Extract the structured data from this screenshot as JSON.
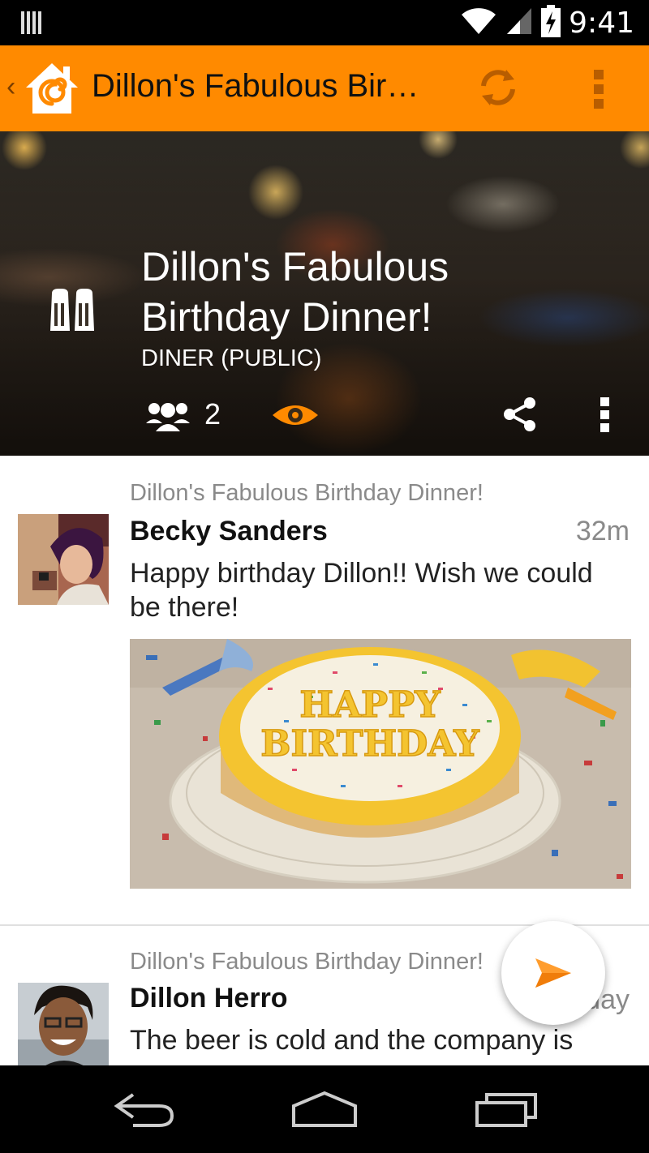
{
  "status_bar": {
    "time": "9:41"
  },
  "action_bar": {
    "title": "Dillon's Fabulous Birt…"
  },
  "event": {
    "title": "Dillon's Fabulous Birthday Dinner!",
    "type_label": "DINER (PUBLIC)",
    "attendee_count": "2"
  },
  "posts": [
    {
      "event_title": "Dillon's Fabulous Birthday Dinner!",
      "author": "Becky Sanders",
      "time": "32m",
      "message": "Happy birthday Dillon!! Wish we could be there!",
      "photo_text": "HAPPY BIRTHDAY"
    },
    {
      "event_title": "Dillon's Fabulous Birthday Dinner!",
      "author": "Dillon Herro",
      "time": "1 day",
      "message": "The beer is cold and the company is"
    }
  ],
  "colors": {
    "accent": "#ff8a00",
    "accent_dark": "#e0780a"
  }
}
